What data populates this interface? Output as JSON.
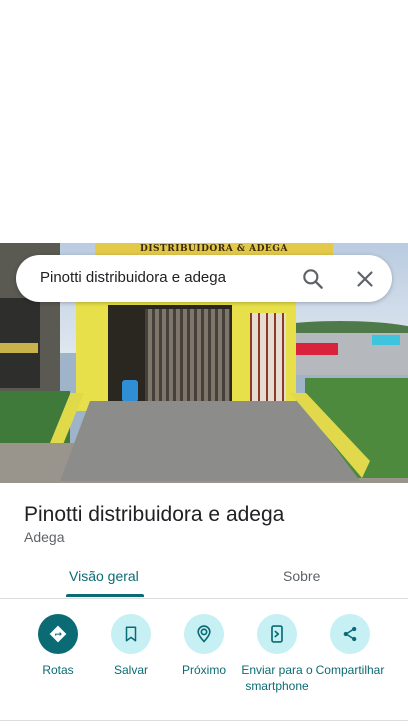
{
  "search": {
    "query": "Pinotti distribuidora e adega"
  },
  "photo": {
    "sign_text": "DISTRIBUIDORA & ADEGA"
  },
  "place": {
    "title": "Pinotti distribuidora e adega",
    "category": "Adega"
  },
  "tabs": [
    {
      "label": "Visão geral",
      "selected": true
    },
    {
      "label": "Sobre",
      "selected": false
    }
  ],
  "actions": [
    {
      "label": "Rotas",
      "icon": "directions-icon"
    },
    {
      "label": "Salvar",
      "icon": "bookmark-icon"
    },
    {
      "label": "Próximo",
      "icon": "nearby-icon"
    },
    {
      "label": "Enviar para o smartphone",
      "icon": "send-to-phone-icon"
    },
    {
      "label": "Compartilhar",
      "icon": "share-icon"
    }
  ],
  "colors": {
    "accent": "#0b6b74",
    "chip_bg": "#c6f0f4",
    "muted_text": "#5f6368"
  }
}
